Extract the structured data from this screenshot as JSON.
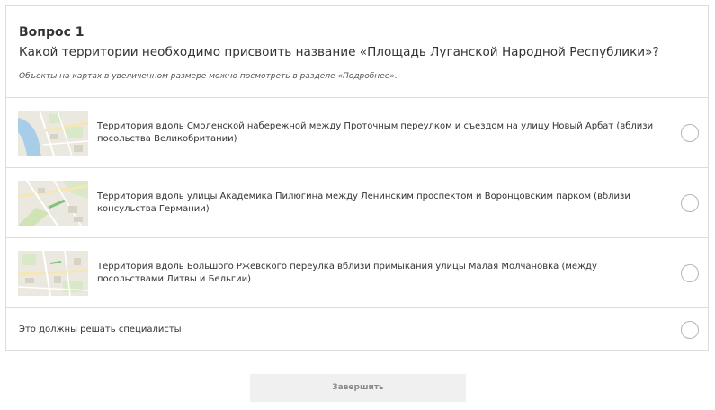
{
  "question": {
    "number_label": "Вопрос 1",
    "text": "Какой территории необходимо присвоить название «Площадь Луганской Народной Республики»?",
    "hint": "Объекты на картах в увеличенном размере можно посмотреть в разделе «Подробнее»."
  },
  "options": [
    {
      "text": "Территория вдоль Смоленской набережной между Проточным переулком и съездом на улицу Новый Арбат (вблизи посольства Великобритании)",
      "thumbnail_icon": "map-thumbnail"
    },
    {
      "text": "Территория вдоль улицы Академика Пилюгина между Ленинским проспектом и Воронцовским парком (вблизи консульства Германии)",
      "thumbnail_icon": "map-thumbnail"
    },
    {
      "text": "Территория вдоль Большого Ржевского переулка вблизи примыкания улицы Малая Молчановка (между посольствами Литвы и Бельгии)",
      "thumbnail_icon": "map-thumbnail"
    },
    {
      "text": "Это должны решать специалисты"
    }
  ],
  "finish_button": {
    "label": "Завершить"
  },
  "colors": {
    "border": "#dcdcdc",
    "text": "#333333",
    "button_bg": "#f0f0f0",
    "button_text": "#8a8a8a",
    "map_water": "#a8cde8",
    "map_park": "#cfe3b5",
    "map_highlight": "#7cc576"
  }
}
